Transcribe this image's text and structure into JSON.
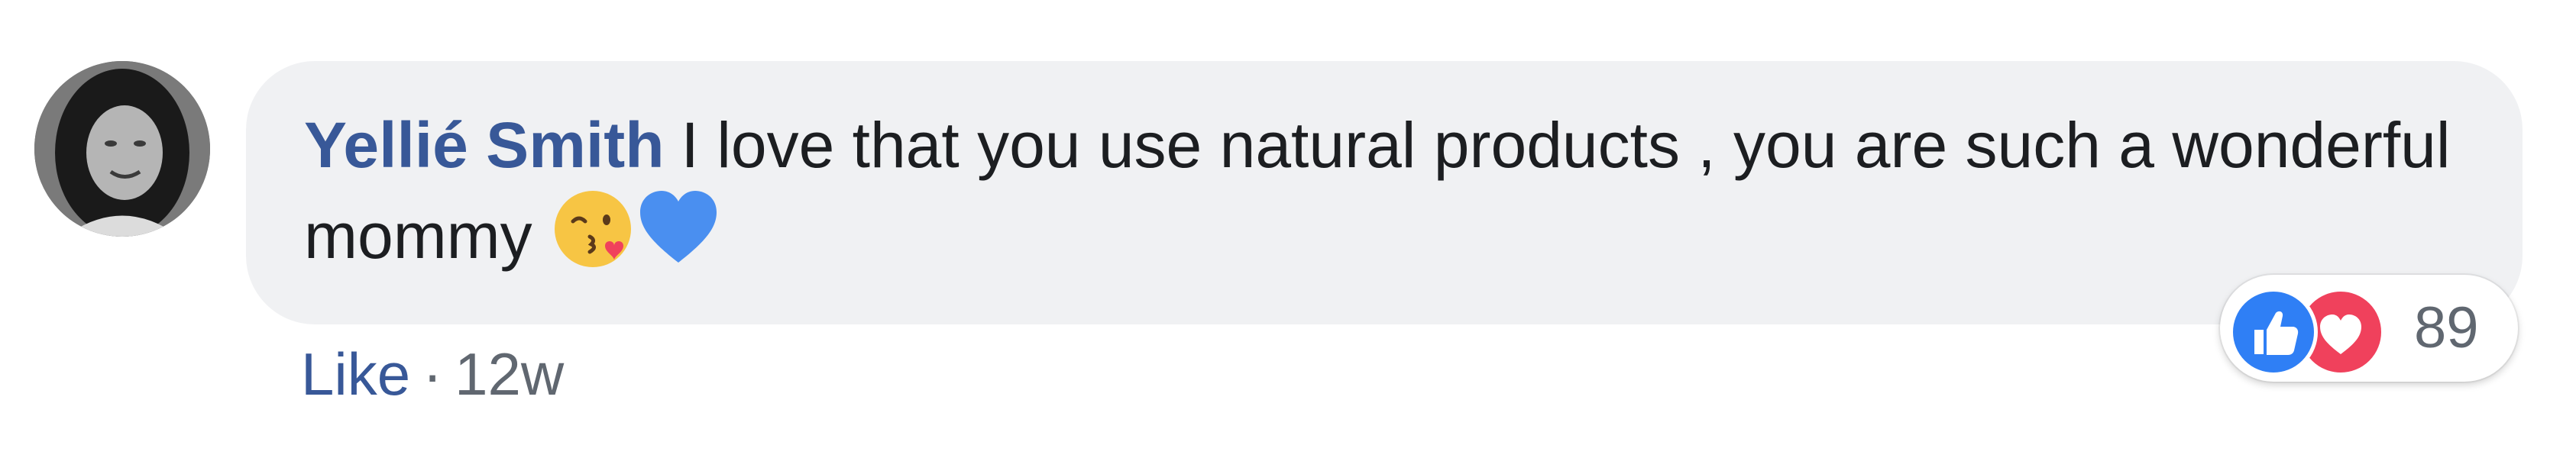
{
  "comment": {
    "author": "Yellié Smith",
    "text": "I love that you use natural products , you are such a wonderful mommy",
    "emojis": [
      "kissing-face-wink-icon",
      "blue-heart-icon"
    ]
  },
  "actions": {
    "like_label": "Like",
    "separator": "·",
    "time": "12w"
  },
  "reactions": {
    "icons": [
      "like-reaction-icon",
      "love-reaction-icon"
    ],
    "count": "89"
  },
  "colors": {
    "author": "#385898",
    "bubble": "#f0f1f3",
    "like_reaction": "#2f7ff5",
    "love_reaction": "#f0415c",
    "meta_text": "#606770"
  }
}
